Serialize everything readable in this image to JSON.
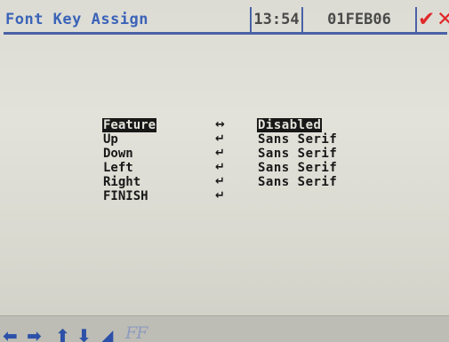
{
  "header": {
    "title": "Font Key Assign",
    "time": "13:54",
    "date": "01FEB06",
    "confirm_icon": "check-icon",
    "cancel_icon": "x-icon",
    "accent_color": "#3b63b8",
    "status_color": "#e02a2a"
  },
  "menu": {
    "rows": [
      {
        "label": "Feature",
        "arrow": "↔",
        "value": "Disabled"
      },
      {
        "label": "Up",
        "arrow": "↵",
        "value": "Sans Serif"
      },
      {
        "label": "Down",
        "arrow": "↵",
        "value": "Sans Serif"
      },
      {
        "label": "Left",
        "arrow": "↵",
        "value": "Sans Serif"
      },
      {
        "label": "Right",
        "arrow": "↵",
        "value": "Sans Serif"
      },
      {
        "label": "FINISH",
        "arrow": "↵"
      }
    ]
  },
  "footer": {
    "icons": [
      "left-arrow-icon",
      "right-arrow-icon",
      "up-arrow-icon",
      "down-arrow-icon",
      "enter-icon"
    ],
    "font_toggle": "FF"
  }
}
